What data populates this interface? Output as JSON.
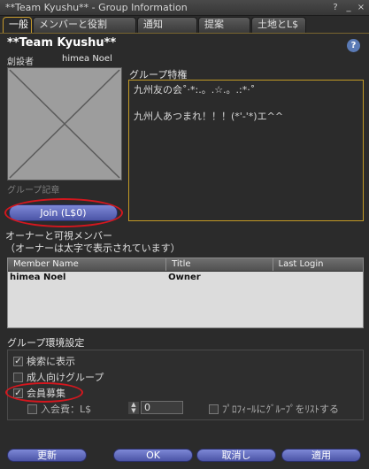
{
  "window": {
    "title": "**Team Kyushu** - Group Information",
    "help_glyph": "?",
    "min_glyph": "_",
    "close_glyph": "×"
  },
  "tabs": [
    {
      "label": "一般"
    },
    {
      "label": "メンバーと役割"
    },
    {
      "label": "通知"
    },
    {
      "label": "提案"
    },
    {
      "label": "土地とL$"
    }
  ],
  "group": {
    "name": "**Team Kyushu**",
    "founder_label": "創設者",
    "founder_name": "himea Noel",
    "insignia_label": "グループ記章"
  },
  "join_button": {
    "label": "Join (L$0)"
  },
  "charter": {
    "label": "グループ特権",
    "line1": "九州友の会˚·*:.。.☆.。.:*·˚",
    "line2": "九州人あつまれ！！！(*'-'*)エ^^"
  },
  "owners": {
    "label": "オーナーと可視メンバー",
    "sublabel": "（オーナーは太字で表示されています）"
  },
  "member_table": {
    "columns": [
      "Member Name",
      "Title",
      "Last Login"
    ],
    "rows": [
      {
        "name": "himea Noel",
        "title": "Owner",
        "last_login": ""
      }
    ]
  },
  "preferences": {
    "label": "グループ環境設定",
    "show_in_search": {
      "label": "検索に表示",
      "checked": true
    },
    "mature": {
      "label": "成人向けグループ",
      "checked": false
    },
    "open_enrollment": {
      "label": "会員募集",
      "checked": true
    },
    "enrollment_fee": {
      "label": "入会費：L$",
      "value": "0",
      "checked": false
    },
    "list_in_profile": {
      "label": "ﾌﾟﾛﾌｨｰﾙにｸﾞﾙｰﾌﾟをﾘｽﾄする",
      "checked": false
    },
    "check_glyph": "✓"
  },
  "footer": {
    "refresh": "更新",
    "ok": "OK",
    "cancel": "取消し",
    "apply": "適用"
  }
}
